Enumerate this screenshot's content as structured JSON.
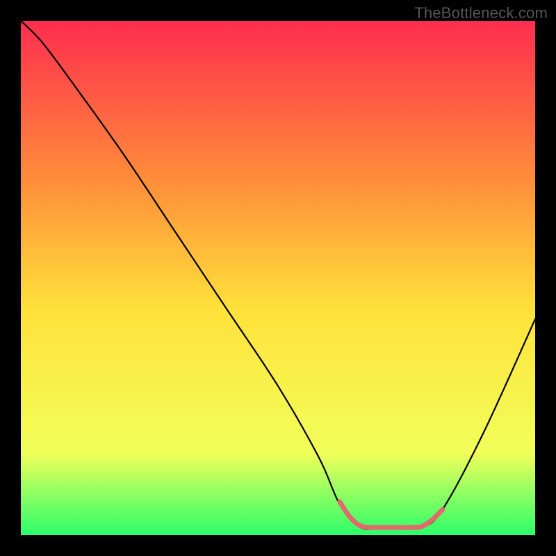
{
  "watermark": "TheBottleneck.com",
  "chart_data": {
    "type": "line",
    "title": "",
    "xlabel": "",
    "ylabel": "",
    "xlim": [
      0,
      100
    ],
    "ylim": [
      0,
      100
    ],
    "grid": false,
    "legend": false,
    "background_gradient": {
      "top": "#ff2d4f",
      "mid_upper": "#ff8a3a",
      "mid": "#ffe13a",
      "lower": "#f2ff5a",
      "bottom": "#2bff6a"
    },
    "series": [
      {
        "name": "main-curve",
        "color": "#000000",
        "x": [
          0,
          4,
          10,
          20,
          30,
          40,
          50,
          58,
          62,
          66,
          70,
          74,
          78,
          82,
          90,
          100
        ],
        "y": [
          100,
          96,
          88,
          74,
          59,
          44,
          29,
          15,
          6,
          1.5,
          1.5,
          1.5,
          1.5,
          5,
          20,
          42
        ]
      },
      {
        "name": "highlight-segment",
        "color": "#e16a6a",
        "x": [
          62,
          64,
          66,
          68,
          70,
          72,
          74,
          76,
          78,
          80,
          82
        ],
        "y": [
          6.5,
          3.5,
          1.8,
          1.5,
          1.5,
          1.5,
          1.5,
          1.5,
          1.7,
          3.0,
          5.0
        ]
      }
    ]
  }
}
